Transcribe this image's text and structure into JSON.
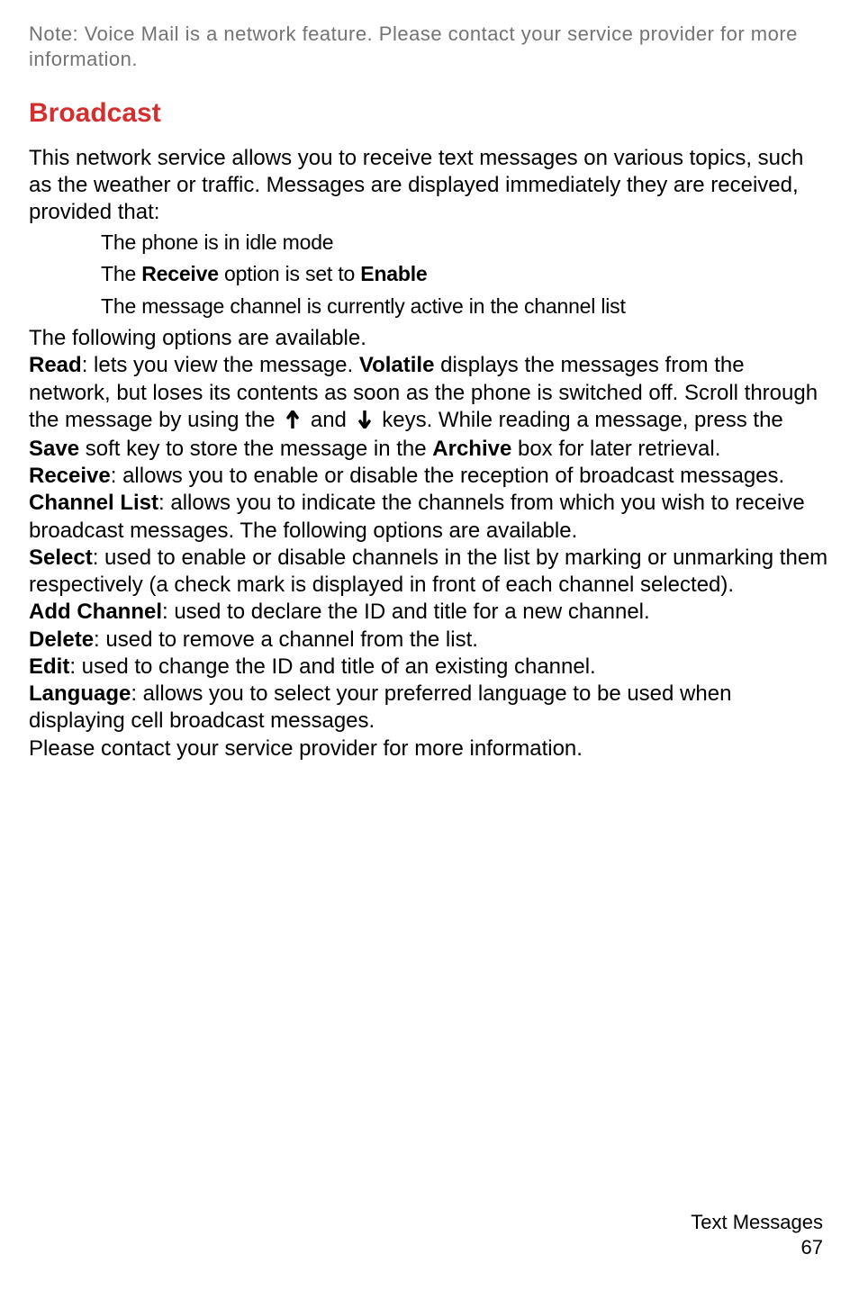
{
  "note": "Note: Voice Mail is a network feature. Please contact your service provider for more information.",
  "heading": "Broadcast",
  "intro": "This network service allows you to receive text messages on various topics, such as the weather or traffic. Messages are displayed immediately they are received, provided that:",
  "bullets": {
    "b1": "The phone is in idle mode",
    "b2_pre": "The ",
    "b2_bold1": "Receive",
    "b2_mid": " option is set to ",
    "b2_bold2": "Enable",
    "b3": "The message channel is currently active in the channel list"
  },
  "options_intro": "The following options are available.",
  "read": {
    "label": "Read",
    "t1": ": lets you view the message. ",
    "volatile": "Volatile",
    "t2": " displays the messages from the network, but loses its contents as soon as the phone is switched off. Scroll through the message by using the ",
    "and": " and ",
    "t3": " keys. While reading a message, press the ",
    "save": "Save",
    "t4": " soft key to store the message in the ",
    "archive": "Archive",
    "t5": " box for later retrieval."
  },
  "receive": {
    "label": "Receive",
    "text": ": allows you to enable or disable the reception of broadcast messages."
  },
  "channel_list": {
    "label": "Channel List",
    "text": ": allows you to indicate the channels from which you wish to receive broadcast messages. The following options are available."
  },
  "select": {
    "label": "Select",
    "text": ": used to enable or disable channels in the list by marking or unmarking them respectively (a check mark is displayed in front of each channel selected)."
  },
  "add_channel": {
    "label": "Add Channel",
    "text": ": used to declare the ID and title for a new channel."
  },
  "delete": {
    "label": "Delete",
    "text": ": used to remove a channel from the list."
  },
  "edit": {
    "label": "Edit",
    "text": ": used to change the ID and title of an existing channel."
  },
  "language": {
    "label": "Language",
    "text": ": allows you to select your preferred language to be used when displaying cell broadcast messages."
  },
  "closing": "Please contact your service provider for more information.",
  "footer": {
    "section": "Text Messages",
    "page": "67"
  }
}
